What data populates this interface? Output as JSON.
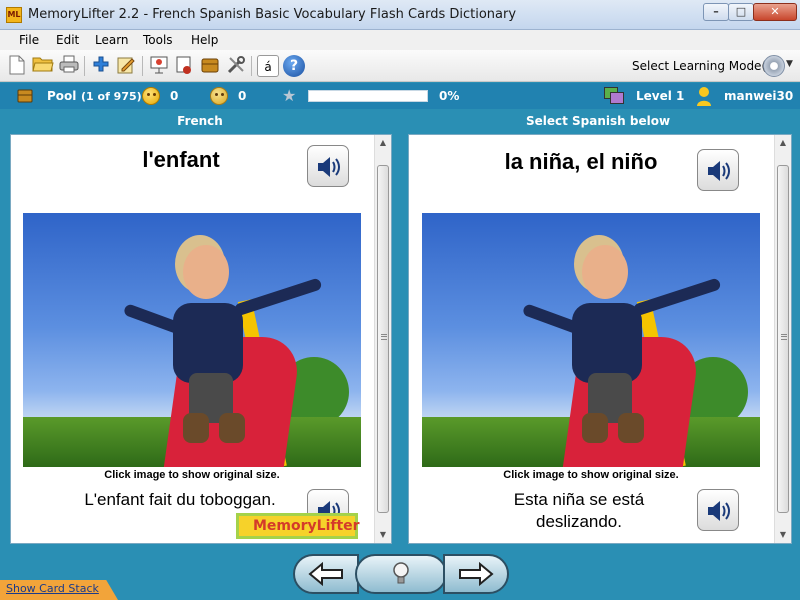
{
  "window": {
    "icon_text": "ML",
    "title": "MemoryLifter 2.2 - French Spanish Basic Vocabulary Flash Cards Dictionary",
    "minimize": "–",
    "maximize": "□",
    "close": "✕"
  },
  "menu": [
    "File",
    "Edit",
    "Learn",
    "Tools",
    "Help"
  ],
  "toolbar": {
    "icons": [
      "new-icon",
      "open-icon",
      "print-icon",
      "add-icon",
      "edit-icon",
      "slideshow-icon",
      "learn-icon",
      "chest-icon",
      "settings-tools-icon",
      "character-map-icon",
      "help-icon"
    ],
    "char_map_glyph": "á",
    "help_glyph": "?",
    "select_mode_label": "Select Learning Mode(s)"
  },
  "status": {
    "pool_label": "Pool",
    "pool_count": "(1 of 975)",
    "correct_count": "0",
    "wrong_count": "0",
    "progress_fraction": 0.0,
    "progress_label": "0%",
    "level_label": "Level 1",
    "user_name": "manwei30"
  },
  "columns": {
    "left_header": "French",
    "right_header": "Select Spanish below"
  },
  "question": {
    "word": "l'enfant",
    "caption": "Click image to show original size.",
    "example": "L'enfant fait du toboggan."
  },
  "answer": {
    "word": "la niña, el niño",
    "caption": "Click image to show original size.",
    "example_line1": "Esta niña se está",
    "example_line2": "deslizando."
  },
  "watermark": "MemoryLifter",
  "footer": {
    "show_card_stack": "Show Card Stack"
  },
  "colors": {
    "accent_bg": "#2a8fb4",
    "status_bar": "#2182b0",
    "progress_fill": "#7ac943",
    "card_stack_tab": "#f2a43a"
  }
}
